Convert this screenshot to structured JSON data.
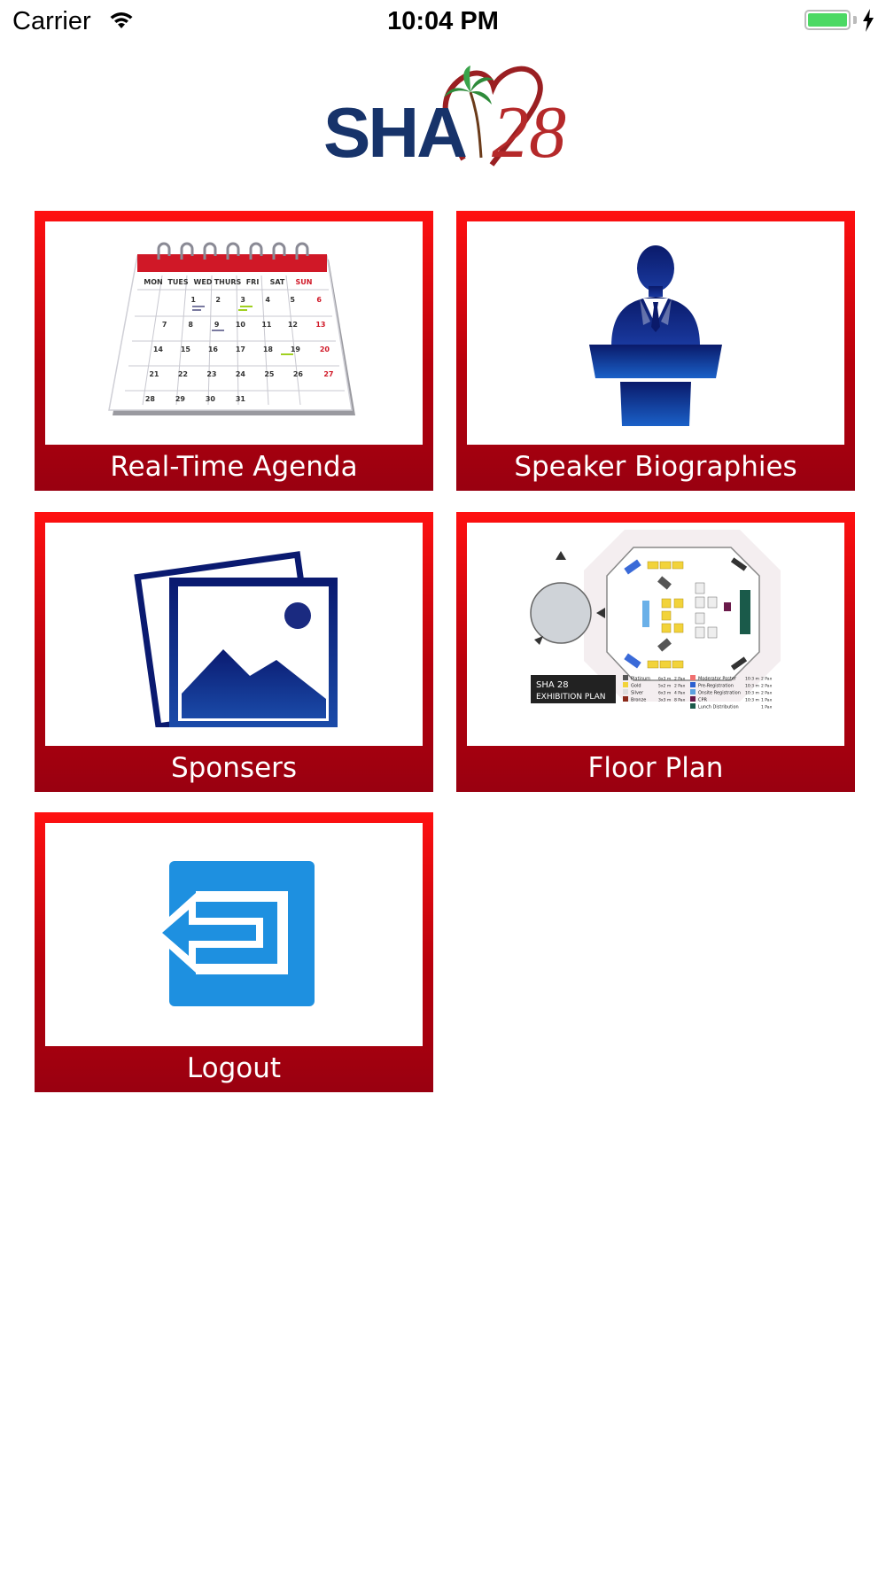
{
  "status_bar": {
    "carrier": "Carrier",
    "time": "10:04 PM",
    "wifi_icon": "wifi-icon",
    "battery_icon": "battery-icon",
    "charging_icon": "bolt-icon",
    "battery_color": "#4cd964"
  },
  "logo": {
    "text": "SHA",
    "number": "28",
    "brand_blue": "#17336a",
    "brand_red": "#b5292a"
  },
  "tiles": [
    {
      "label": "Real-Time Agenda",
      "icon": "calendar-icon"
    },
    {
      "label": "Speaker Biographies",
      "icon": "speaker-podium-icon"
    },
    {
      "label": "Sponsers",
      "icon": "image-gallery-icon"
    },
    {
      "label": "Floor Plan",
      "icon": "floor-plan-icon"
    },
    {
      "label": "Logout",
      "icon": "logout-icon"
    }
  ],
  "calendar": {
    "days": [
      "MON",
      "TUES",
      "WED",
      "THURS",
      "FRI",
      "SAT",
      "SUN"
    ],
    "weeks": [
      [
        "",
        "1",
        "2",
        "3",
        "4",
        "5",
        "6"
      ],
      [
        "7",
        "8",
        "9",
        "10",
        "11",
        "12",
        "13"
      ],
      [
        "14",
        "15",
        "16",
        "17",
        "18",
        "19",
        "20"
      ],
      [
        "21",
        "22",
        "23",
        "24",
        "25",
        "26",
        "27"
      ],
      [
        "28",
        "29",
        "30",
        "31",
        "",
        "",
        ""
      ]
    ]
  },
  "floor_plan": {
    "title_line1": "SHA 28",
    "title_line2": "EXHIBITION PLAN",
    "legend": [
      {
        "name": "Platinum",
        "size": "6x3 m",
        "pax": "2 Pax",
        "color": "#555555"
      },
      {
        "name": "Gold",
        "size": "5x2 m",
        "pax": "2 Pax",
        "color": "#f2d33a"
      },
      {
        "name": "Silver",
        "size": "6x3 m",
        "pax": "4 Pax",
        "color": "#dddddd"
      },
      {
        "name": "Bronze",
        "size": "3x3 m",
        "pax": "8 Pax",
        "color": "#8b2a1a"
      },
      {
        "name": "Moderator Poster",
        "size": "10:3 m",
        "pax": "2 Pax",
        "color": "#f07070"
      },
      {
        "name": "Pre-Registration",
        "size": "10:3 m",
        "pax": "2 Pax",
        "color": "#2a5fd0"
      },
      {
        "name": "Onsite Registration",
        "size": "10:3 m",
        "pax": "2 Pax",
        "color": "#5aa0e0"
      },
      {
        "name": "CPR",
        "size": "10:3 m",
        "pax": "1 Pax",
        "color": "#6a1a4a"
      },
      {
        "name": "Lunch Distribution",
        "size": "",
        "pax": "1 Pax",
        "color": "#1a5a4a"
      }
    ]
  }
}
